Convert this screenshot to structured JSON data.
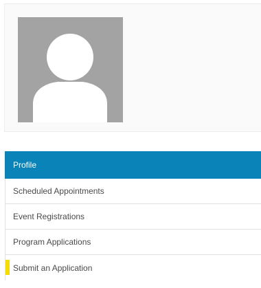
{
  "profile_card": {
    "avatar_icon": "user-silhouette-icon"
  },
  "nav": {
    "items": [
      {
        "label": "Profile",
        "active": true
      },
      {
        "label": "Scheduled Appointments",
        "active": false
      },
      {
        "label": "Event Registrations",
        "active": false
      },
      {
        "label": "Program Applications",
        "active": false
      },
      {
        "label": "Submit an Application",
        "active": false,
        "highlighted": true
      }
    ]
  },
  "colors": {
    "active_bg": "#0a84b8",
    "highlight": "#f5dc00",
    "avatar_bg": "#a3a3a3"
  }
}
